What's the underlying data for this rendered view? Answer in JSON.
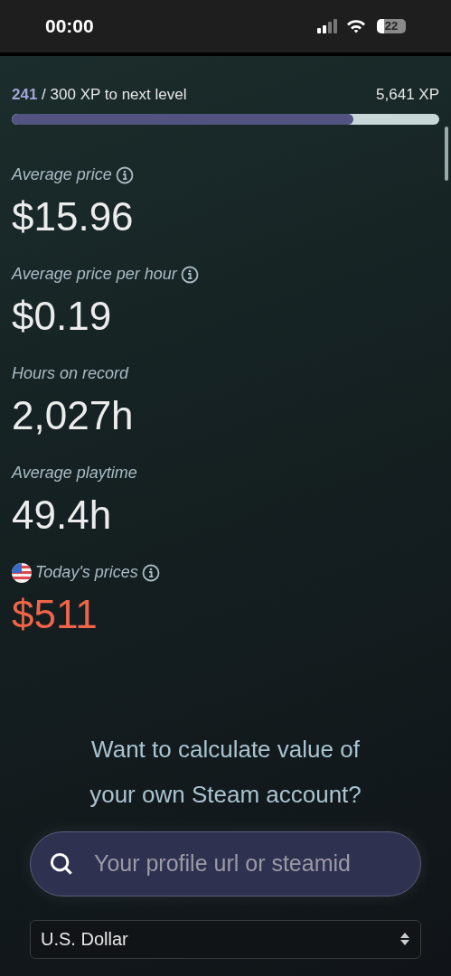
{
  "status_bar": {
    "time": "00:00",
    "battery": "22"
  },
  "xp": {
    "current": "241",
    "rest": "/ 300 XP to next level",
    "total": "5,641 XP",
    "level": 0.8
  },
  "stats": [
    {
      "label": "Average price",
      "value": "$15.96",
      "info": true,
      "flag": false,
      "accent": false
    },
    {
      "label": "Average price per hour",
      "value": "$0.19",
      "info": true,
      "flag": false,
      "accent": false
    },
    {
      "label": "Hours on record",
      "value": "2,027h",
      "info": false,
      "flag": false,
      "accent": false
    },
    {
      "label": "Average playtime",
      "value": "49.4h",
      "info": false,
      "flag": false,
      "accent": false
    },
    {
      "label": "Today's prices",
      "value": "$511",
      "info": true,
      "flag": true,
      "accent": true
    }
  ],
  "callout": {
    "lines": [
      "Want to calculate value of",
      "your own Steam account?"
    ]
  },
  "search": {
    "placeholder": "Your profile url or steamid"
  },
  "currency": {
    "value": "U.S. Dollar"
  }
}
